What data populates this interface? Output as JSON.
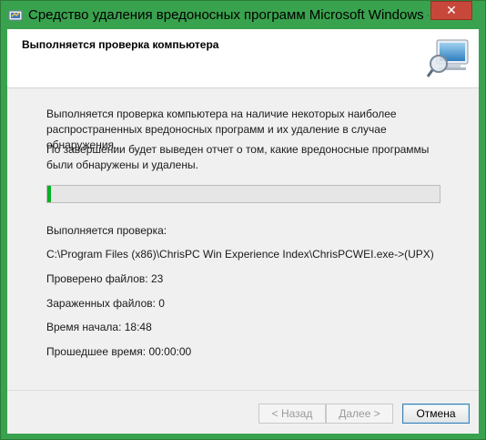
{
  "window": {
    "title": "Средство удаления вредоносных программ Microsoft Windows - ...",
    "close_glyph": "✕",
    "accent_color": "#39a24e"
  },
  "header": {
    "title": "Выполняется проверка компьютера",
    "image_icon": "scanner-computer-icon"
  },
  "body": {
    "paragraph1": "Выполняется проверка компьютера на наличие некоторых наиболее распространенных вредоносных программ и их удаление в случае обнаружения.",
    "paragraph2": "По завершении будет выведен отчет о том, какие вредоносные программы были обнаружены и удалены.",
    "progress_percent": 1,
    "scanning_label": "Выполняется проверка:",
    "scanning_path": "C:\\Program Files (x86)\\ChrisPC Win Experience Index\\ChrisPCWEI.exe->(UPX)",
    "files_checked": "Проверено файлов: 23",
    "infected_files": "Зараженных файлов: 0",
    "start_time": "Время начала: 18:48",
    "elapsed_time": "Прошедшее время: 00:00:00"
  },
  "footer": {
    "back_label": "< Назад",
    "next_label": "Далее >",
    "cancel_label": "Отмена"
  }
}
